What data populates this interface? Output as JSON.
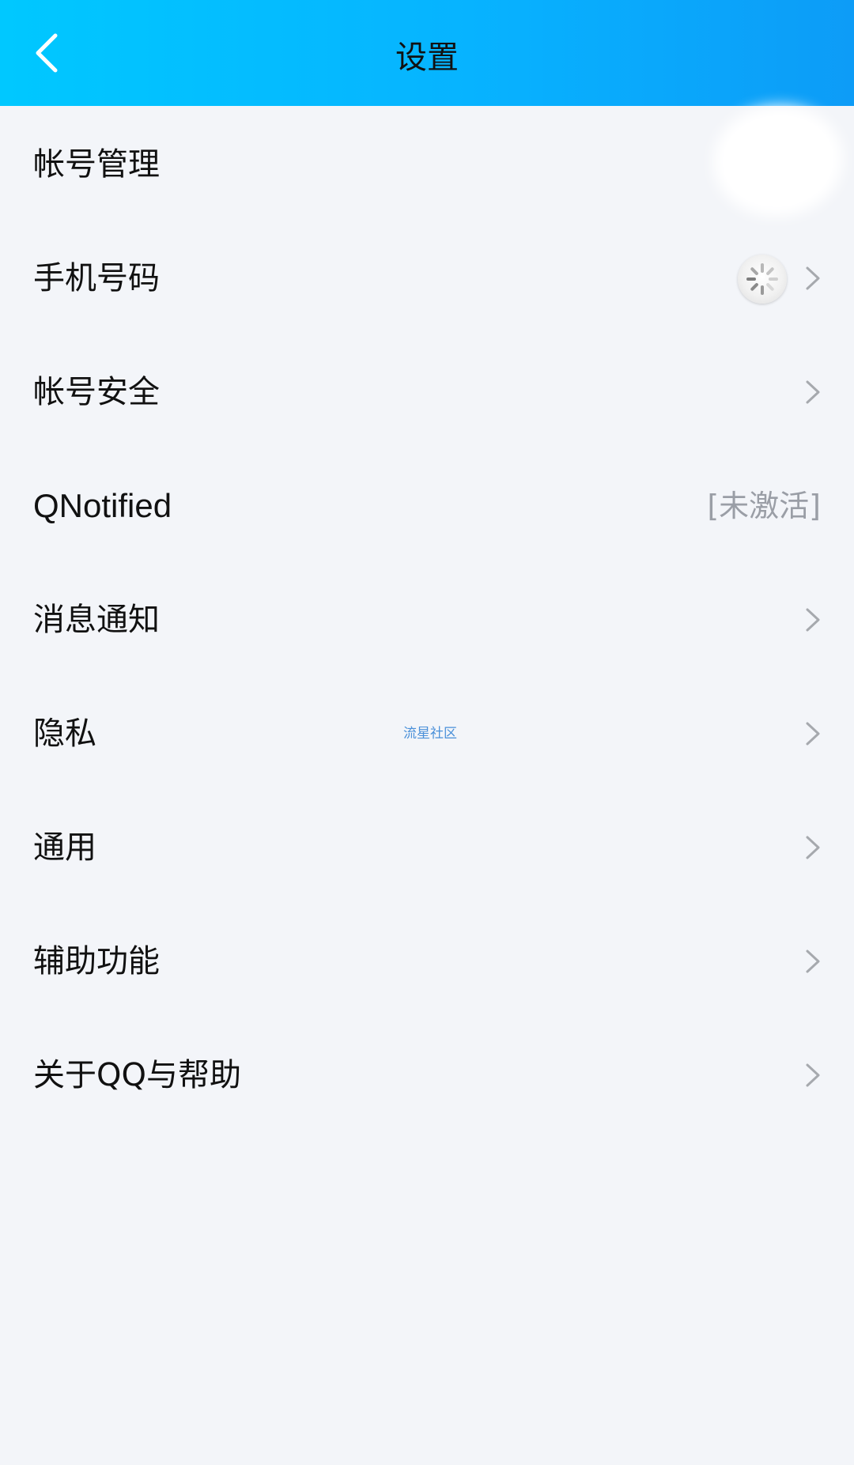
{
  "header": {
    "title": "设置",
    "back_icon": "chevron-left-icon",
    "gradient": [
      "#00c8ff",
      "#0d9cf7"
    ]
  },
  "items": [
    {
      "label": "帐号管理",
      "accessory": "avatar"
    },
    {
      "label": "手机号码",
      "accessory": "spinner-chevron"
    },
    {
      "label": "帐号安全",
      "accessory": "chevron"
    },
    {
      "label": "QNotified",
      "accessory": "status",
      "status": "[未激活]"
    },
    {
      "label": "消息通知",
      "accessory": "chevron"
    },
    {
      "label": "隐私",
      "accessory": "chevron",
      "watermark": "流星社区"
    },
    {
      "label": "通用",
      "accessory": "chevron"
    },
    {
      "label": "辅助功能",
      "accessory": "chevron"
    },
    {
      "label": "关于QQ与帮助",
      "accessory": "chevron"
    }
  ],
  "colors": {
    "background": "#f3f5f9",
    "text": "#111111",
    "secondary_text": "#9a9ea6",
    "chevron": "#a6a9ae",
    "watermark": "#4a90d9"
  }
}
